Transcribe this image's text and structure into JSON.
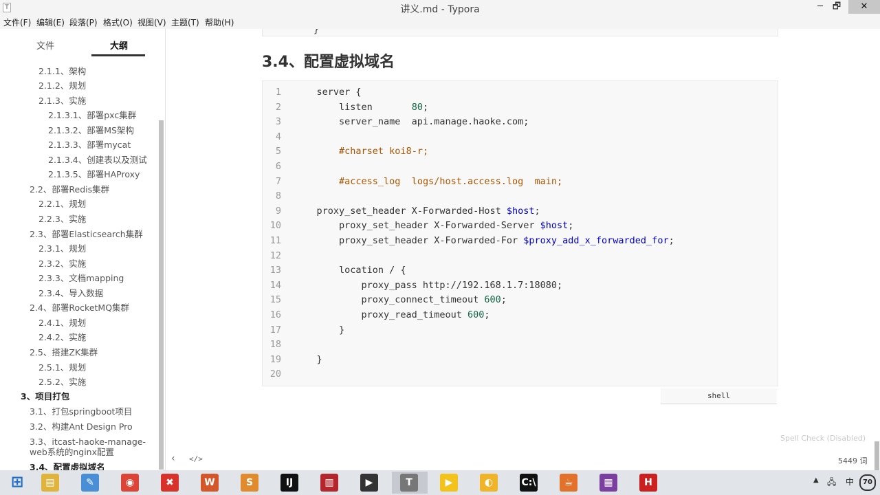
{
  "window": {
    "title": "讲义.md - Typora",
    "app_icon_glyph": "T",
    "min": "─",
    "max": "🗗",
    "close": "✕"
  },
  "menu": [
    "文件(F)",
    "编辑(E)",
    "段落(P)",
    "格式(O)",
    "视图(V)",
    "主题(T)",
    "帮助(H)"
  ],
  "sidebar": {
    "tabs": [
      "文件",
      "大纲"
    ],
    "active_tab": "大纲",
    "outline": [
      "2.1.1、架构",
      "2.1.2、规划",
      "2.1.3、实施",
      "2.1.3.1、部署pxc集群",
      "2.1.3.2、部署MS架构",
      "2.1.3.3、部署mycat",
      "2.1.3.4、创建表以及测试",
      "2.1.3.5、部署HAProxy",
      "2.2、部署Redis集群",
      "2.2.1、规划",
      "2.2.3、实施",
      "2.3、部署Elasticsearch集群",
      "2.3.1、规划",
      "2.3.2、实施",
      "2.3.3、文档mapping",
      "2.3.4、导入数据",
      "2.4、部署RocketMQ集群",
      "2.4.1、规划",
      "2.4.2、实施",
      "2.5、搭建ZK集群",
      "2.5.1、规划",
      "2.5.2、实施",
      "3、项目打包",
      "3.1、打包springboot项目",
      "3.2、构建Ant Design Pro",
      "3.3、itcast-haoke-manage-",
      "web系统的nginx配置",
      "3.4、配置虚拟域名"
    ]
  },
  "editor": {
    "previous_block_tail": "}",
    "heading": "3.4、配置虚拟域名",
    "code_language": "shell",
    "code_lines": [
      {
        "n": "1",
        "tokens": [
          {
            "t": "    server {",
            "c": ""
          }
        ]
      },
      {
        "n": "2",
        "tokens": [
          {
            "t": "        listen       ",
            "c": ""
          },
          {
            "t": "80",
            "c": "num"
          },
          {
            "t": ";",
            "c": ""
          }
        ]
      },
      {
        "n": "3",
        "tokens": [
          {
            "t": "        server_name  api.manage.haoke.com;",
            "c": ""
          }
        ]
      },
      {
        "n": "4",
        "tokens": []
      },
      {
        "n": "5",
        "tokens": [
          {
            "t": "        ",
            "c": ""
          },
          {
            "t": "#charset koi8-r;",
            "c": "com"
          }
        ]
      },
      {
        "n": "6",
        "tokens": []
      },
      {
        "n": "7",
        "tokens": [
          {
            "t": "        ",
            "c": ""
          },
          {
            "t": "#access_log  logs/host.access.log  main;",
            "c": "com"
          }
        ]
      },
      {
        "n": "8",
        "tokens": []
      },
      {
        "n": "9",
        "tokens": [
          {
            "t": "    proxy_set_header X-Forwarded-Host ",
            "c": ""
          },
          {
            "t": "$host",
            "c": "var"
          },
          {
            "t": ";",
            "c": ""
          }
        ]
      },
      {
        "n": "10",
        "tokens": [
          {
            "t": "        proxy_set_header X-Forwarded-Server ",
            "c": ""
          },
          {
            "t": "$host",
            "c": "var"
          },
          {
            "t": ";",
            "c": ""
          }
        ]
      },
      {
        "n": "11",
        "tokens": [
          {
            "t": "        proxy_set_header X-Forwarded-For ",
            "c": ""
          },
          {
            "t": "$proxy_add_x_forwarded_for",
            "c": "var"
          },
          {
            "t": ";",
            "c": ""
          }
        ]
      },
      {
        "n": "12",
        "tokens": []
      },
      {
        "n": "13",
        "tokens": [
          {
            "t": "        location / {",
            "c": ""
          }
        ]
      },
      {
        "n": "14",
        "tokens": [
          {
            "t": "            proxy_pass http://192.168.1.7:18080;",
            "c": ""
          }
        ]
      },
      {
        "n": "15",
        "tokens": [
          {
            "t": "            proxy_connect_timeout ",
            "c": ""
          },
          {
            "t": "600",
            "c": "num"
          },
          {
            "t": ";",
            "c": ""
          }
        ]
      },
      {
        "n": "16",
        "tokens": [
          {
            "t": "            proxy_read_timeout ",
            "c": ""
          },
          {
            "t": "600",
            "c": "num"
          },
          {
            "t": ";",
            "c": ""
          }
        ]
      },
      {
        "n": "17",
        "tokens": [
          {
            "t": "        }",
            "c": ""
          }
        ]
      },
      {
        "n": "18",
        "tokens": []
      },
      {
        "n": "19",
        "tokens": [
          {
            "t": "    }",
            "c": ""
          }
        ]
      },
      {
        "n": "20",
        "tokens": []
      }
    ]
  },
  "status": {
    "spell_check": "Spell Check (Disabled)",
    "word_count": "5449 词",
    "back": "‹",
    "source_toggle": "</>"
  },
  "taskbar": {
    "apps": [
      {
        "name": "windows-start",
        "glyph": "⊞",
        "color": "#1e6fc7"
      },
      {
        "name": "file-explorer",
        "glyph": "▤",
        "color": "#e0b43c"
      },
      {
        "name": "paint",
        "glyph": "✎",
        "color": "#4a8fd6"
      },
      {
        "name": "chrome",
        "glyph": "◉",
        "color": "#db4437"
      },
      {
        "name": "xmind",
        "glyph": "✖",
        "color": "#d9322b"
      },
      {
        "name": "app-w",
        "glyph": "W",
        "color": "#d4572a"
      },
      {
        "name": "sublime",
        "glyph": "S",
        "color": "#e08b2e"
      },
      {
        "name": "intellij",
        "glyph": "IJ",
        "color": "#111111"
      },
      {
        "name": "notebook",
        "glyph": "▥",
        "color": "#b5262c"
      },
      {
        "name": "terminal-app",
        "glyph": "▶",
        "color": "#333333"
      },
      {
        "name": "typora",
        "glyph": "T",
        "color": "#777777"
      },
      {
        "name": "player",
        "glyph": "▶",
        "color": "#f3c31b"
      },
      {
        "name": "hadoop",
        "glyph": "◐",
        "color": "#f0b429"
      },
      {
        "name": "cmd",
        "glyph": "C:\\",
        "color": "#111111"
      },
      {
        "name": "java",
        "glyph": "☕",
        "color": "#e2712b"
      },
      {
        "name": "winrar",
        "glyph": "▦",
        "color": "#7b3fa0"
      },
      {
        "name": "h-app",
        "glyph": "H",
        "color": "#cc1f1f"
      }
    ],
    "active_app": "typora",
    "tray": {
      "arrow": "▲",
      "network": "🖧",
      "ime": "中",
      "badge": "70"
    }
  }
}
